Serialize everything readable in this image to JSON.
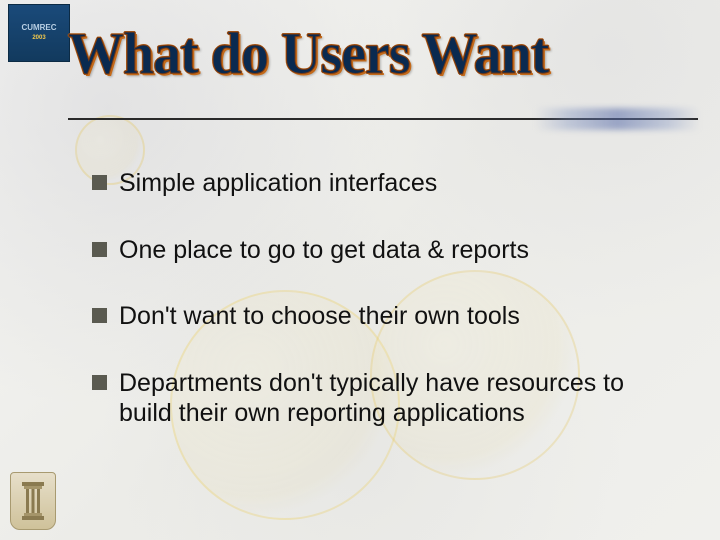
{
  "logo_top": {
    "line1": "CUMREC",
    "line2": "2003"
  },
  "title": "What do Users Want",
  "bullets": [
    "Simple application interfaces",
    "One place to go to get data & reports",
    "Don't want to choose their own tools",
    "Departments don't typically have resources to build their own reporting applications"
  ]
}
